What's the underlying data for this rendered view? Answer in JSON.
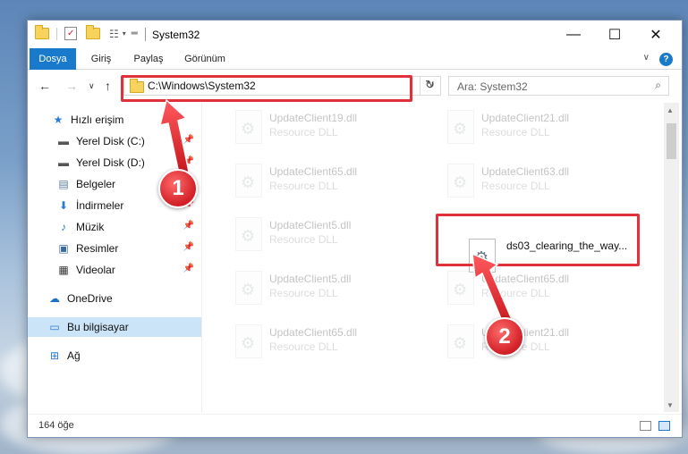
{
  "window": {
    "title": "System32",
    "controls": {
      "minimize": "—",
      "maximize": "☐",
      "close": "✕"
    }
  },
  "ribbon": {
    "tabs": [
      "Dosya",
      "Giriş",
      "Paylaş",
      "Görünüm"
    ],
    "help": "?"
  },
  "navigation": {
    "address": "C:\\Windows\\System32",
    "search_placeholder": "Ara: System32"
  },
  "sidebar": {
    "items": [
      {
        "label": "Hızlı erişim",
        "icon": "star-icon",
        "pinned": false
      },
      {
        "label": "Yerel Disk (C:)",
        "icon": "drive-icon",
        "pinned": true
      },
      {
        "label": "Yerel Disk (D:)",
        "icon": "drive-icon",
        "pinned": true
      },
      {
        "label": "Belgeler",
        "icon": "documents-icon",
        "pinned": true
      },
      {
        "label": "İndirmeler",
        "icon": "download-icon",
        "pinned": true
      },
      {
        "label": "Müzik",
        "icon": "music-icon",
        "pinned": true
      },
      {
        "label": "Resimler",
        "icon": "pictures-icon",
        "pinned": true
      },
      {
        "label": "Videolar",
        "icon": "videos-icon",
        "pinned": true
      },
      {
        "label": "OneDrive",
        "icon": "cloud-icon",
        "pinned": false
      },
      {
        "label": "Bu bilgisayar",
        "icon": "computer-icon",
        "pinned": false
      },
      {
        "label": "Ağ",
        "icon": "network-icon",
        "pinned": false
      }
    ]
  },
  "files": [
    {
      "name": "UpdateClient19.dll",
      "type": "Resource DLL"
    },
    {
      "name": "UpdateClient21.dll",
      "type": "Resource DLL"
    },
    {
      "name": "UpdateClient65.dll",
      "type": "Resource DLL"
    },
    {
      "name": "UpdateClient63.dll",
      "type": "Resource DLL"
    },
    {
      "name": "UpdateClient5.dll",
      "type": "Resource DLL"
    },
    {
      "name": "ds03_clearing_the_way...",
      "type": ""
    },
    {
      "name": "UpdateClient5.dll",
      "type": "Resource DLL"
    },
    {
      "name": "UpdateClient65.dll",
      "type": "Resource DLL"
    },
    {
      "name": "UpdateClient65.dll",
      "type": "Resource DLL"
    },
    {
      "name": "UpdateClient21.dll",
      "type": "Resource DLL"
    }
  ],
  "status": {
    "count": "164 öğe"
  },
  "callouts": [
    "1",
    "2"
  ],
  "colors": {
    "accent": "#1979ca",
    "highlight": "#e0303a"
  }
}
